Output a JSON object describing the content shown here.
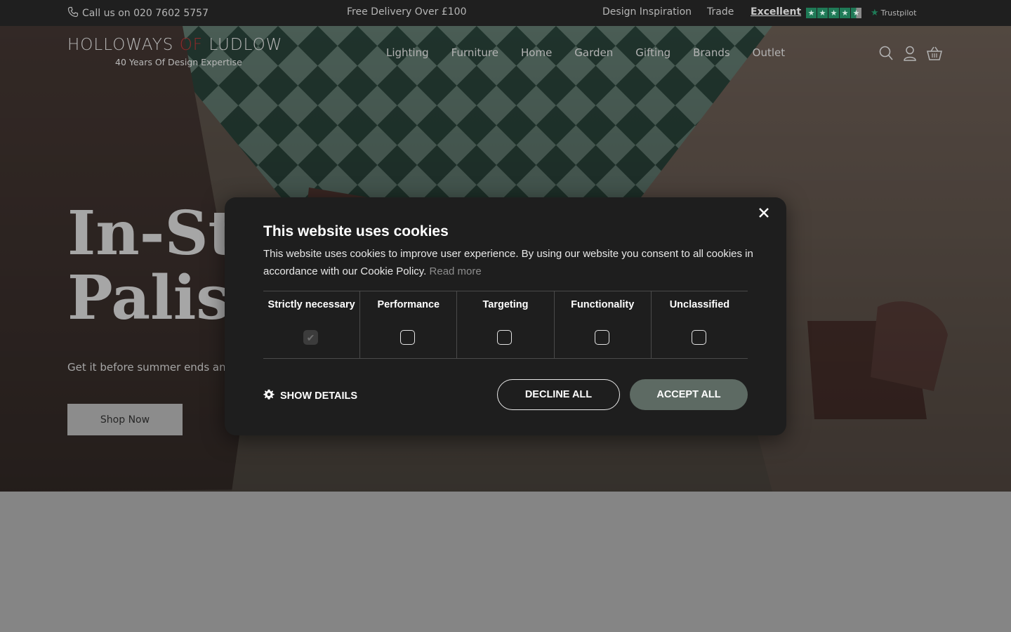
{
  "topbar": {
    "phone": "Call us on 020 7602 5757",
    "delivery": "Free Delivery Over £100",
    "inspiration": "Design Inspiration",
    "trade": "Trade",
    "rating_word": "Excellent",
    "rating_stars": 4.5,
    "trustpilot": "Trustpilot"
  },
  "header": {
    "logo_part1": "HOLLOWAYS ",
    "logo_part2": "OF",
    "logo_part3": " LUDLOW",
    "tagline": "40 Years Of Design Expertise",
    "nav": [
      "Lighting",
      "Furniture",
      "Home",
      "Garden",
      "Gifting",
      "Brands",
      "Outlet"
    ],
    "icons": [
      "search-icon",
      "account-icon",
      "basket-icon"
    ]
  },
  "hero": {
    "title_line1": "In-Sto",
    "title_line2": "Paliss",
    "subtitle": "Get it before summer ends and",
    "cta": "Shop Now"
  },
  "cookie": {
    "title": "This website uses cookies",
    "description": "This website uses cookies to improve user experience. By using our website you consent to all cookies in accordance with our Cookie Policy.",
    "read_more": "Read more",
    "categories": [
      {
        "label": "Strictly necessary",
        "checked": true
      },
      {
        "label": "Performance",
        "checked": false
      },
      {
        "label": "Targeting",
        "checked": false
      },
      {
        "label": "Functionality",
        "checked": false
      },
      {
        "label": "Unclassified",
        "checked": false
      }
    ],
    "show_details": "SHOW DETAILS",
    "decline": "DECLINE ALL",
    "accept": "ACCEPT ALL"
  },
  "colors": {
    "topbar_bg": "#1f1f1f",
    "modal_bg": "#1e1e1e",
    "accept_bg": "#5d6a63",
    "trustpilot_green": "#1f7a57",
    "logo_accent": "#8e2a2a"
  }
}
